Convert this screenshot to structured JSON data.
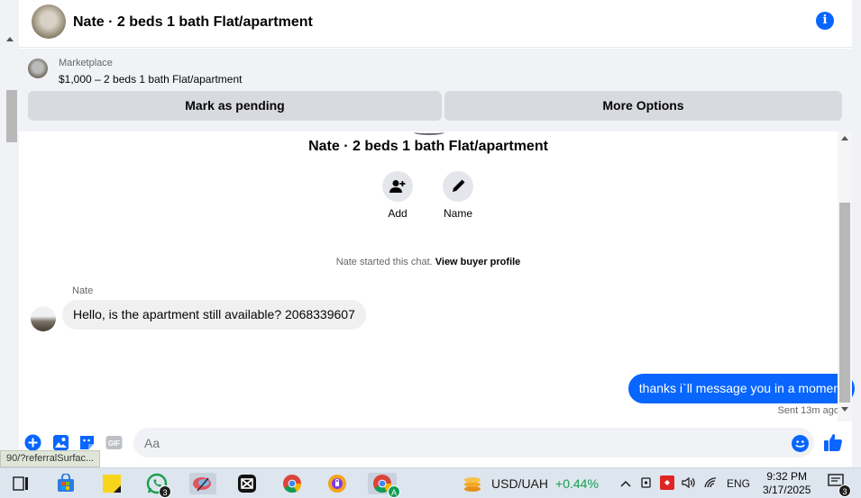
{
  "header": {
    "title": "Nate · 2 beds 1 bath Flat/apartment"
  },
  "marketplace": {
    "label": "Marketplace",
    "listing": "$1,000 – 2 beds 1 bath Flat/apartment",
    "mark_pending": "Mark as pending",
    "more_options": "More Options"
  },
  "conversation": {
    "title": "Nate · 2 beds 1 bath Flat/apartment",
    "actions": [
      {
        "label": "Add"
      },
      {
        "label": "Name"
      }
    ],
    "started_text": "Nate started this chat.",
    "buyer_profile_link": "View buyer profile",
    "messages": [
      {
        "sender": "Nate",
        "text": "Hello, is the apartment still available? 2068339607"
      },
      {
        "text": "thanks i`ll message you in a moment",
        "status": "Sent 13m ago"
      }
    ]
  },
  "composer": {
    "placeholder": "Aa",
    "gif_label": "GIF"
  },
  "status_url": "90/?referralSurfac...",
  "taskbar": {
    "whatsapp_badge": "3",
    "ticker_name": "USD/UAH",
    "ticker_change": "+0.44%",
    "language": "ENG",
    "time": "9:32 PM",
    "date": "3/17/2025",
    "notification_badge": "3",
    "chrome_profile": "A"
  },
  "colors": {
    "accent": "#0866ff",
    "positive": "#12a150"
  }
}
